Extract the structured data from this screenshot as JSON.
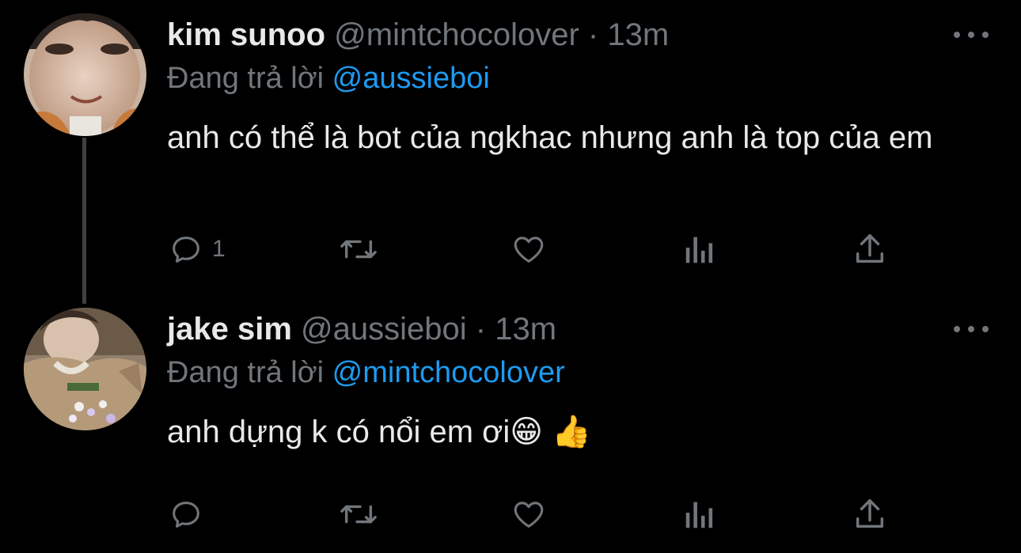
{
  "tweets": [
    {
      "display_name": "kim sunoo",
      "handle": "@mintchocolover",
      "separator": "·",
      "time": "13m",
      "replying_prefix": "Đang trả lời",
      "replying_to": "@aussieboi",
      "text": "anh có thể là bot của ngkhac nhưng anh là top của em",
      "reply_count": "1",
      "avatar_icon": "profile-photo-sunoo"
    },
    {
      "display_name": "jake sim",
      "handle": "@aussieboi",
      "separator": "·",
      "time": "13m",
      "replying_prefix": "Đang trả lời",
      "replying_to": "@mintchocolover",
      "text": "anh dựng k có nổi em ơi😁 👍",
      "reply_count": "",
      "avatar_icon": "profile-photo-jake"
    }
  ],
  "icons": {
    "reply": "reply-icon",
    "retweet": "retweet-icon",
    "like": "like-icon",
    "stats": "stats-icon",
    "share": "share-icon",
    "more": "more-options-icon"
  },
  "colors": {
    "background": "#000000",
    "text": "#e7e9ea",
    "muted": "#71767b",
    "link": "#1d9bf0",
    "thread_line": "#3e4144"
  }
}
